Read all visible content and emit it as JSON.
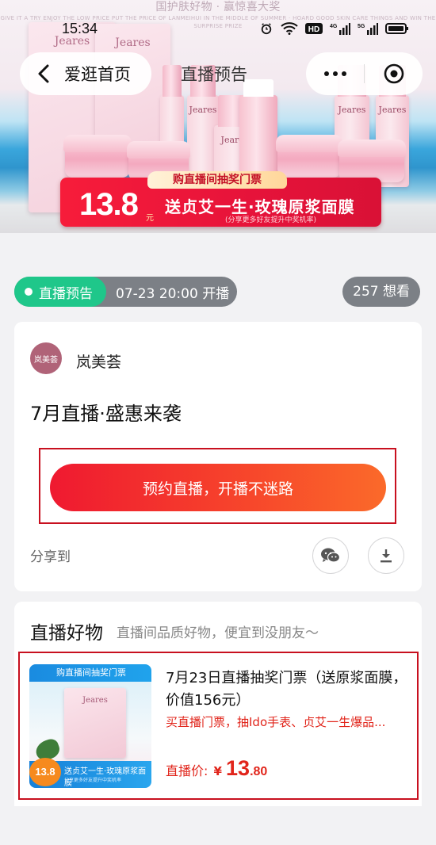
{
  "status_bar": {
    "time": "15:34",
    "network_labels": [
      "HD",
      "4G",
      "5G"
    ]
  },
  "nav": {
    "back_label": "爱逛首页",
    "title": "直播预告"
  },
  "banner": {
    "slogan": "国护肤好物 · 赢惊喜大奖",
    "slogan_en": "GIVE IT A TRY ENJOY THE LOW PRICE PUT THE PRICE OF LANMEIHUI IN THE MIDDLE OF SUMMER · HOARD GOOD SKIN CARE THINGS AND WIN THE SURPRISE PRIZE",
    "product_brand": "Jeares",
    "promo_tab": "购直播间抽奖门票",
    "promo_price": "13.8",
    "promo_unit": "元",
    "promo_main": "送贞艾一生·玫瑰原浆面膜",
    "promo_sub": "(分享更多好友提升中奖机率)"
  },
  "live_status": {
    "badge": "直播预告",
    "time_text": "07-23 20:00 开播",
    "want_text": "257 想看"
  },
  "card": {
    "avatar_text": "岚美荟",
    "shop_name": "岚美荟",
    "live_title": "7月直播·盛惠来袭",
    "reserve_label": "预约直播，开播不迷路",
    "share_label": "分享到"
  },
  "goods": {
    "title": "直播好物",
    "subtitle": "直播间品质好物，便宜到没朋友～",
    "product": {
      "thumb_top": "购直播间抽奖门票",
      "thumb_brand": "Jeares",
      "thumb_price": "13.8",
      "thumb_strip": "送贞艾一生·玫瑰原浆面膜",
      "thumb_strip_sub": "分享更多好友提升中奖机率",
      "name": "7月23日直播抽奖门票（送原浆面膜，价值156元）",
      "desc": "买直播门票，抽Ido手表、贞艾一生爆品...",
      "price_label": "直播价:",
      "currency": "¥",
      "price_int": "13",
      "price_dec": ".80"
    }
  },
  "colors": {
    "accent_red": "#e1251b",
    "live_green": "#1fc78a",
    "button_gradient_start": "#ef1930",
    "button_gradient_end": "#fb6a2a"
  }
}
